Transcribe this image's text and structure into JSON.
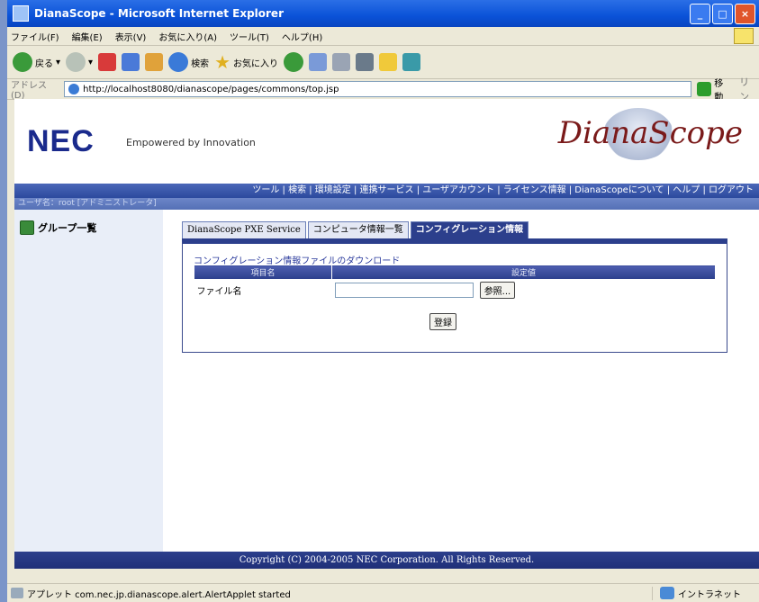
{
  "window": {
    "title": "DianaScope - Microsoft Internet Explorer",
    "controls": {
      "minimize": "_",
      "maximize": "□",
      "close": "×"
    }
  },
  "menu": [
    "ファイル(F)",
    "編集(E)",
    "表示(V)",
    "お気に入り(A)",
    "ツール(T)",
    "ヘルプ(H)"
  ],
  "toolbar": {
    "back": "戻る",
    "search": "検索",
    "favorites": "お気に入り"
  },
  "address": {
    "label": "アドレス(D)",
    "url": "http://localhost8080/dianascope/pages/commons/top.jsp",
    "go": "移動",
    "links": "リン"
  },
  "header": {
    "nec": "NEC",
    "tagline": "Empowered by Innovation",
    "product": "DianaScope"
  },
  "nav": {
    "items": "ツール | 検索 | 環境設定 | 連携サービス | ユーザアカウント | ライセンス情報 | DianaScopeについて | ヘルプ | ログアウト",
    "user": "ユーザ名：root [アドミニストレータ]"
  },
  "sidebar": {
    "group_list": "グループ一覧"
  },
  "tabs": [
    {
      "label": "DianaScope PXE Service"
    },
    {
      "label": "コンピュータ情報一覧"
    },
    {
      "label": "コンフィグレーション情報"
    }
  ],
  "panel": {
    "download_link": "コンフィグレーション情報ファイルのダウンロード",
    "col_item": "項目名",
    "col_value": "設定値",
    "file_label": "ファイル名",
    "browse": "参照...",
    "submit": "登録"
  },
  "footer": {
    "copyright": "Copyright (C) 2004-2005 NEC Corporation. All Rights Reserved."
  },
  "status": {
    "message": "アプレット com.nec.jp.dianascope.alert.AlertApplet started",
    "zone": "イントラネット"
  }
}
